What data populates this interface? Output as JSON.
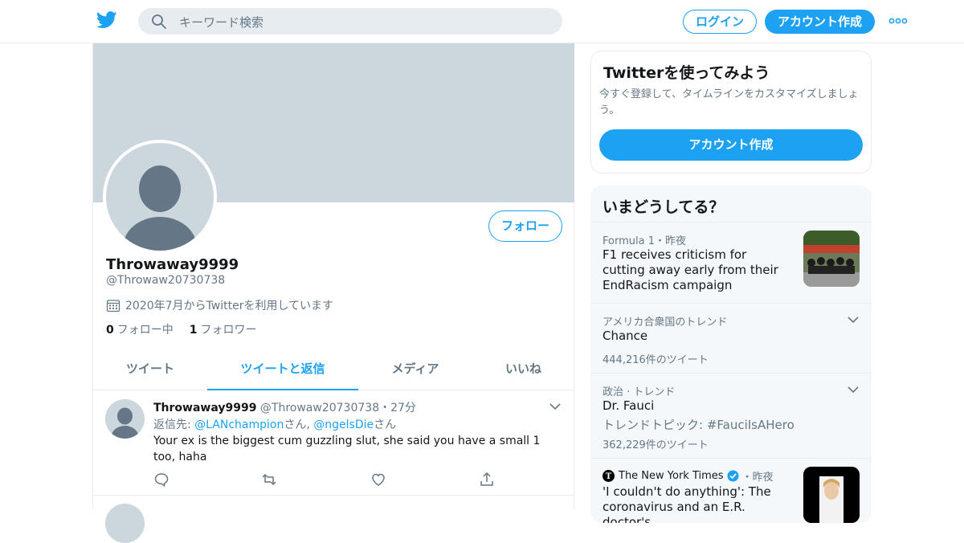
{
  "topbar": {
    "logo_icon": "twitter-bird-icon",
    "search_placeholder": "キーワード検索",
    "login_label": "ログイン",
    "signup_label": "アカウント作成",
    "more_icon": "more-dots-icon",
    "accent": "#1da1f2"
  },
  "profile": {
    "name": "Throwaway9999",
    "handle": "@Throwaw20730738",
    "joined": "2020年7月からTwitterを利用しています",
    "following_count": "0",
    "following_label": "フォロー中",
    "followers_count": "1",
    "followers_label": "フォロワー",
    "follow_button": "フォロー"
  },
  "tabs": [
    {
      "label": "ツイート",
      "active": false
    },
    {
      "label": "ツイートと返信",
      "active": true
    },
    {
      "label": "メディア",
      "active": false
    },
    {
      "label": "いいね",
      "active": false
    }
  ],
  "tweet": {
    "name": "Throwaway9999",
    "handle": "@Throwaw20730738",
    "separator": "・",
    "time": "27分",
    "reply_prefix": "返信先: ",
    "reply_user1": "@LANchampion",
    "reply_suffix1": "さん, ",
    "reply_user2": "@ngelsDie",
    "reply_suffix2": "さん",
    "text": "Your ex is the biggest cum guzzling slut, she said you have a small 1 too, haha"
  },
  "signup_card": {
    "title": "Twitterを使ってみよう",
    "description": "今すぐ登録して、タイムラインをカスタマイズしましょう。",
    "button": "アカウント作成"
  },
  "trends": {
    "title": "いまどうしてる？",
    "items": [
      {
        "meta": "Formula 1・昨夜",
        "headline": "F1 receives criticism for cutting away early from their EndRacism campaign"
      },
      {
        "meta": "アメリカ合衆国のトレンド",
        "headline": "Chance",
        "count": "444,216件のツイート"
      },
      {
        "meta": "政治 · トレンド",
        "headline": "Dr. Fauci",
        "sub": "トレンドトピック: #FauciIsAHero",
        "count": "362,229件のツイート"
      },
      {
        "meta_source": "The New York Times",
        "meta_time": "・昨夜",
        "headline": "'I couldn't do anything': The coronavirus and an E.R. doctor's"
      }
    ]
  }
}
